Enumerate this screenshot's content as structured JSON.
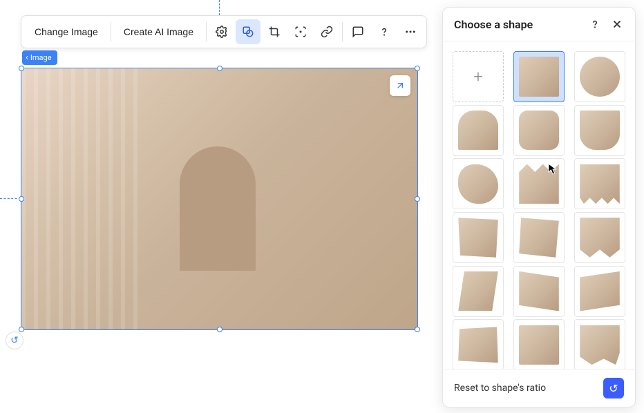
{
  "toolbar": {
    "change_image": "Change Image",
    "create_ai_image": "Create AI Image",
    "icons": {
      "settings": "settings",
      "shape": "shape-mask",
      "crop": "crop",
      "focus": "focal-point",
      "link": "link",
      "comment": "comment",
      "help": "help",
      "more": "more"
    }
  },
  "breadcrumb": {
    "label": "Image"
  },
  "panel": {
    "title": "Choose a shape",
    "help": "help",
    "close": "close",
    "reset_label": "Reset to shape's ratio"
  },
  "shapes": [
    {
      "id": "add",
      "kind": "add",
      "selected": false
    },
    {
      "id": "rect",
      "kind": "thumb",
      "cls": "sh-rect",
      "selected": true
    },
    {
      "id": "circle",
      "kind": "thumb",
      "cls": "sh-circle",
      "selected": false
    },
    {
      "id": "arch",
      "kind": "thumb",
      "cls": "sh-arch",
      "selected": false
    },
    {
      "id": "rounded",
      "kind": "thumb",
      "cls": "sh-rounded",
      "selected": false
    },
    {
      "id": "notch",
      "kind": "thumb",
      "cls": "sh-notch",
      "selected": false
    },
    {
      "id": "blob",
      "kind": "thumb",
      "cls": "sh-blob",
      "selected": false
    },
    {
      "id": "zig",
      "kind": "thumb",
      "cls": "sh-zig",
      "selected": false
    },
    {
      "id": "scallop",
      "kind": "thumb",
      "cls": "sh-scallop",
      "selected": false
    },
    {
      "id": "torn1",
      "kind": "thumb",
      "cls": "sh-torn1",
      "selected": false
    },
    {
      "id": "torn2",
      "kind": "thumb",
      "cls": "sh-torn2",
      "selected": false
    },
    {
      "id": "wave",
      "kind": "thumb",
      "cls": "sh-wave",
      "selected": false
    },
    {
      "id": "trap1",
      "kind": "thumb",
      "cls": "sh-trap1",
      "selected": false
    },
    {
      "id": "trap2",
      "kind": "thumb",
      "cls": "sh-trap2",
      "selected": false
    },
    {
      "id": "trap3",
      "kind": "thumb",
      "cls": "sh-trap3",
      "selected": false
    },
    {
      "id": "brush",
      "kind": "thumb",
      "cls": "sh-brush",
      "selected": false
    },
    {
      "id": "rect2",
      "kind": "thumb",
      "cls": "sh-rect",
      "selected": false
    },
    {
      "id": "organic",
      "kind": "thumb",
      "cls": "sh-organic",
      "selected": false
    }
  ]
}
